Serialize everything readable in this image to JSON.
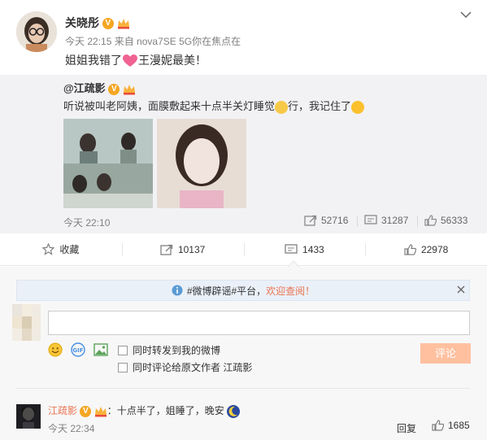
{
  "post": {
    "username": "关晓彤",
    "verified_badge": "V",
    "time": "今天 22:15",
    "source": "来自 nova7SE 5G你在焦点在",
    "text_before": "姐姐我错了",
    "text_after": "王漫妮最美！"
  },
  "repost": {
    "username": "@江疏影",
    "verified_badge": "V",
    "text_part1": "听说被叫老阿姨，面膜敷起来十点半关灯睡觉",
    "text_part2": "行，我记住了",
    "time": "今天 22:10",
    "reposts": "52716",
    "comments": "31287",
    "likes": "56333"
  },
  "actions": {
    "favorite": "收藏",
    "repost_count": "10137",
    "comment_count": "1433",
    "like_count": "22978"
  },
  "composer": {
    "notice_prefix": "#微博辟谣#平台，",
    "notice_link": "欢迎查阅！",
    "input_value": "",
    "opt_repost": "同时转发到我的微博",
    "opt_comment_original": "同时评论给原文作者 江疏影",
    "submit_label": "评论"
  },
  "comment": {
    "username": "江疏影",
    "verified_badge": "V",
    "text": "：十点半了，姐睡了，晚安",
    "time": "今天 22:34",
    "reply_label": "回复",
    "likes": "1685"
  },
  "colors": {
    "accent": "#eb7350",
    "badge": "#f5a623",
    "submit": "#ffc09f",
    "repost_bg": "#f2f2f5",
    "notice_bg": "#eaf0f8"
  },
  "icons": [
    "chevron-down-icon",
    "heart-icon",
    "crown-icon",
    "favorite-icon",
    "repost-icon",
    "comment-icon",
    "like-icon",
    "info-icon",
    "close-icon",
    "smile-icon",
    "gif-icon",
    "image-icon",
    "moon-emoji-icon",
    "cat-emoji-icon",
    "smirk-emoji-icon"
  ]
}
